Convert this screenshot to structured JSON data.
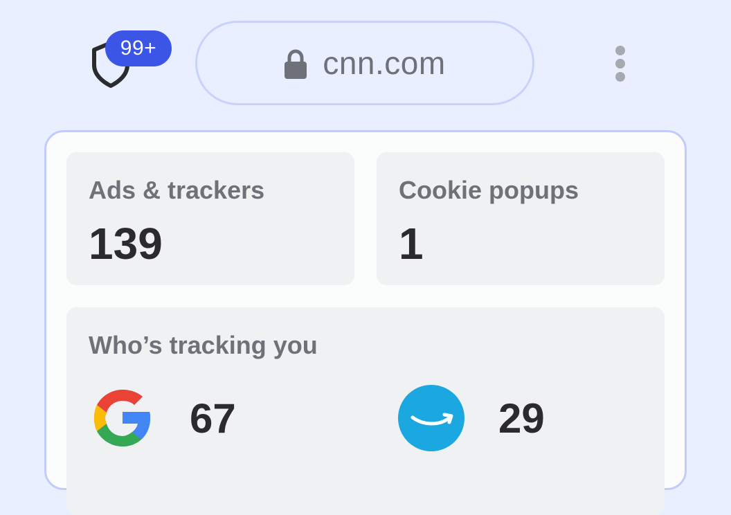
{
  "header": {
    "shield_badge": "99+",
    "url": "cnn.com"
  },
  "stats": {
    "ads_trackers": {
      "label": "Ads & trackers",
      "value": "139"
    },
    "cookie_popups": {
      "label": "Cookie popups",
      "value": "1"
    }
  },
  "trackers": {
    "title": "Who’s tracking you",
    "items": [
      {
        "icon": "google-logo-icon",
        "count": "67"
      },
      {
        "icon": "amazon-logo-icon",
        "count": "29"
      }
    ]
  },
  "colors": {
    "background": "#e9effe",
    "badge": "#3b55e6",
    "panel_border": "#c3cbfb",
    "card": "#f0f1f2"
  }
}
